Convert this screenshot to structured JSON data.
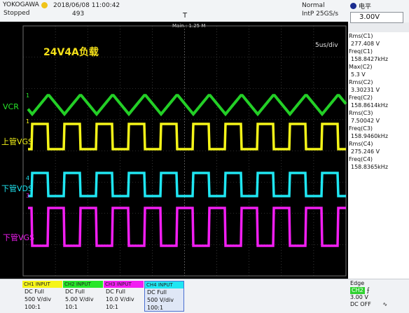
{
  "header": {
    "brand": "YOKOGAWA",
    "run_state": "Stopped",
    "datetime": "2018/06/08 11:00:42",
    "acq_count": "493",
    "acq_mode": "Normal",
    "sample_rate": "IntP  25GS/s",
    "trigger_pos_marker": "T",
    "level_label": "电平",
    "level_value": "3.00V"
  },
  "screen": {
    "main_label": "Main : 1.25 M",
    "timebase": "5us/div",
    "title": "24V4A负载",
    "channel_labels": {
      "ch2": "VCR",
      "ch1": "上管VGS",
      "ch4": "下管VDS",
      "ch3": "下管VGS"
    },
    "markers": {
      "ch2": "1",
      "ch1": "1",
      "ch4": "4",
      "ch3": "3"
    },
    "colors": {
      "ch1": "#f5f518",
      "ch2": "#27e62a",
      "ch3": "#f21ef2",
      "ch4": "#1fe6f2",
      "grid": "#5a5a5a"
    }
  },
  "readouts": [
    {
      "name": "Rms(C1)",
      "value": "277.408 V"
    },
    {
      "name": "Freq(C1)",
      "value": "158.8427kHz"
    },
    {
      "name": "Max(C2)",
      "value": "5.3 V"
    },
    {
      "name": "Rms(C2)",
      "value": "3.30231 V"
    },
    {
      "name": "Freq(C2)",
      "value": "158.8614kHz"
    },
    {
      "name": "Rms(C3)",
      "value": "7.50042 V"
    },
    {
      "name": "Freq(C3)",
      "value": "158.9460kHz"
    },
    {
      "name": "Rms(C4)",
      "value": "275.246 V"
    },
    {
      "name": "Freq(C4)",
      "value": "158.8365kHz"
    }
  ],
  "channels": [
    {
      "head": "CH1 INPUT",
      "coupling": "DC Full",
      "scale": "500 V/div",
      "probe": "100:1",
      "color": "#f5f518"
    },
    {
      "head": "CH2 INPUT",
      "coupling": "DC Full",
      "scale": "5.00 V/div",
      "probe": "10:1",
      "color": "#27e62a"
    },
    {
      "head": "CH3 INPUT",
      "coupling": "DC Full",
      "scale": "10.0 V/div",
      "probe": "10:1",
      "color": "#f21ef2"
    },
    {
      "head": "CH4 INPUT",
      "coupling": "DC Full",
      "scale": "500 V/div",
      "probe": "100:1",
      "color": "#1fe6f2"
    }
  ],
  "trigger": {
    "mode": "Edge",
    "source": "CH2",
    "slope_icon": "rising-edge-icon",
    "level": "3.00 V",
    "hold": "DC OFF"
  }
}
